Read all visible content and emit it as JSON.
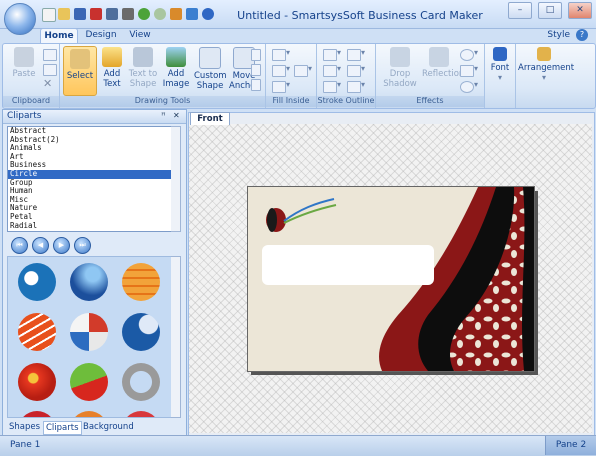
{
  "window": {
    "title": "Untitled - SmartsysSoft Business Card Maker",
    "minimize_glyph": "–",
    "maximize_glyph": "□",
    "close_glyph": "✕"
  },
  "tabs": [
    {
      "label": "Home",
      "active": true
    },
    {
      "label": "Design",
      "active": false
    },
    {
      "label": "View",
      "active": false
    }
  ],
  "style_label": "Style",
  "help_glyph": "?",
  "ribbon": {
    "clipboard": {
      "label": "Clipboard",
      "paste": "Paste"
    },
    "drawing_tools": {
      "label": "Drawing Tools",
      "select": "Select",
      "add_text": "Add Text",
      "text_to_shape": "Text to Shape",
      "add_image": "Add Image",
      "custom_shape": "Custom Shape",
      "move_anchor": "Move Anchor"
    },
    "fill_inside": {
      "label": "Fill Inside"
    },
    "stroke_outline": {
      "label": "Stroke Outline"
    },
    "effects": {
      "label": "Effects",
      "drop_shadow": "Drop Shadow",
      "reflection": "Reflection"
    },
    "font": {
      "label": "Font"
    },
    "arrangement": {
      "label": "Arrangement"
    }
  },
  "left_panel": {
    "title": "Cliparts",
    "pin_glyph": "ꟸ",
    "close_glyph": "✕",
    "categories": [
      "Abstract",
      "Abstract(2)",
      "Animals",
      "Art",
      "Business",
      "Circle",
      "Group",
      "Human",
      "Misc",
      "Nature",
      "Petal",
      "Radial"
    ],
    "selected_category": "Circle",
    "nav_buttons": [
      "first",
      "previous",
      "next",
      "last"
    ],
    "bottom_tabs": [
      {
        "label": "Shapes",
        "active": false
      },
      {
        "label": "Cliparts",
        "active": true
      },
      {
        "label": "Background",
        "active": false
      }
    ]
  },
  "document": {
    "tab_label": "Front"
  },
  "status": {
    "pane1": "Pane 1",
    "pane2": "Pane 2"
  },
  "colors": {
    "accent": "#15428b",
    "card_background": "#ece6d7",
    "card_maroon": "#8b1717",
    "card_black": "#0d0d0d",
    "selection": "#316ac5"
  }
}
